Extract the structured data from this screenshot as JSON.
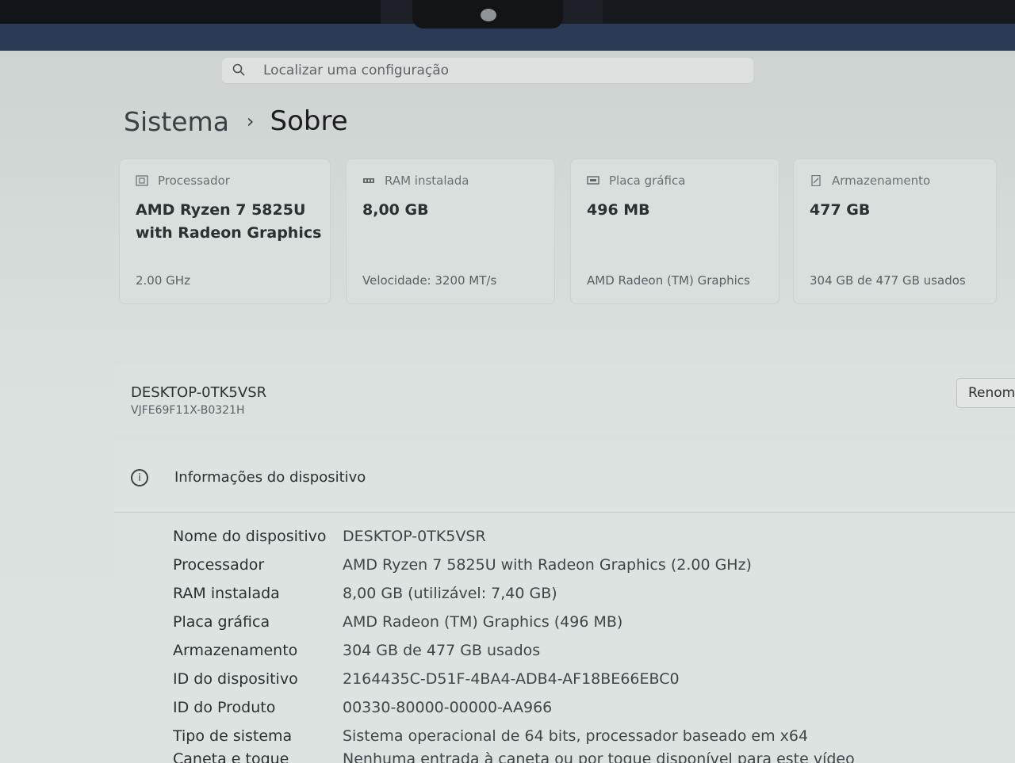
{
  "search": {
    "placeholder": "Localizar uma configuração"
  },
  "breadcrumb": {
    "parent": "Sistema",
    "separator": "›",
    "current": "Sobre"
  },
  "cards": [
    {
      "label": "Processador",
      "value": "AMD Ryzen 7 5825U with Radeon Graphics",
      "sub": "2.00 GHz",
      "icon": "processor-icon"
    },
    {
      "label": "RAM instalada",
      "value": "8,00 GB",
      "sub": "Velocidade: 3200 MT/s",
      "icon": "ram-icon"
    },
    {
      "label": "Placa gráfica",
      "value": "496 MB",
      "sub": "AMD Radeon (TM) Graphics",
      "icon": "graphics-card-icon"
    },
    {
      "label": "Armazenamento",
      "value": "477 GB",
      "sub": "304 GB de 477 GB usados",
      "icon": "storage-icon"
    }
  ],
  "device": {
    "name": "DESKTOP-0TK5VSR",
    "model": "VJFE69F11X-B0321H",
    "rename_label": "Renomear este PC"
  },
  "info": {
    "title": "Informações do dispositivo",
    "rows": [
      {
        "label": "Nome do dispositivo",
        "value": "DESKTOP-0TK5VSR"
      },
      {
        "label": "Processador",
        "value": "AMD Ryzen 7 5825U with Radeon Graphics (2.00 GHz)"
      },
      {
        "label": "RAM instalada",
        "value": "8,00 GB (utilizável: 7,40 GB)"
      },
      {
        "label": "Placa gráfica",
        "value": "AMD Radeon (TM) Graphics (496 MB)"
      },
      {
        "label": "Armazenamento",
        "value": "304 GB de 477 GB usados"
      },
      {
        "label": "ID do dispositivo",
        "value": "2164435C-D51F-4BA4-ADB4-AF18BE66EBC0"
      },
      {
        "label": "ID do Produto",
        "value": "00330-80000-00000-AA966"
      },
      {
        "label": "Tipo de sistema",
        "value": "Sistema operacional de 64 bits, processador baseado em x64"
      },
      {
        "label": "Caneta e toque",
        "value": "Nenhuma entrada à caneta ou por toque disponível para este vídeo"
      }
    ]
  }
}
